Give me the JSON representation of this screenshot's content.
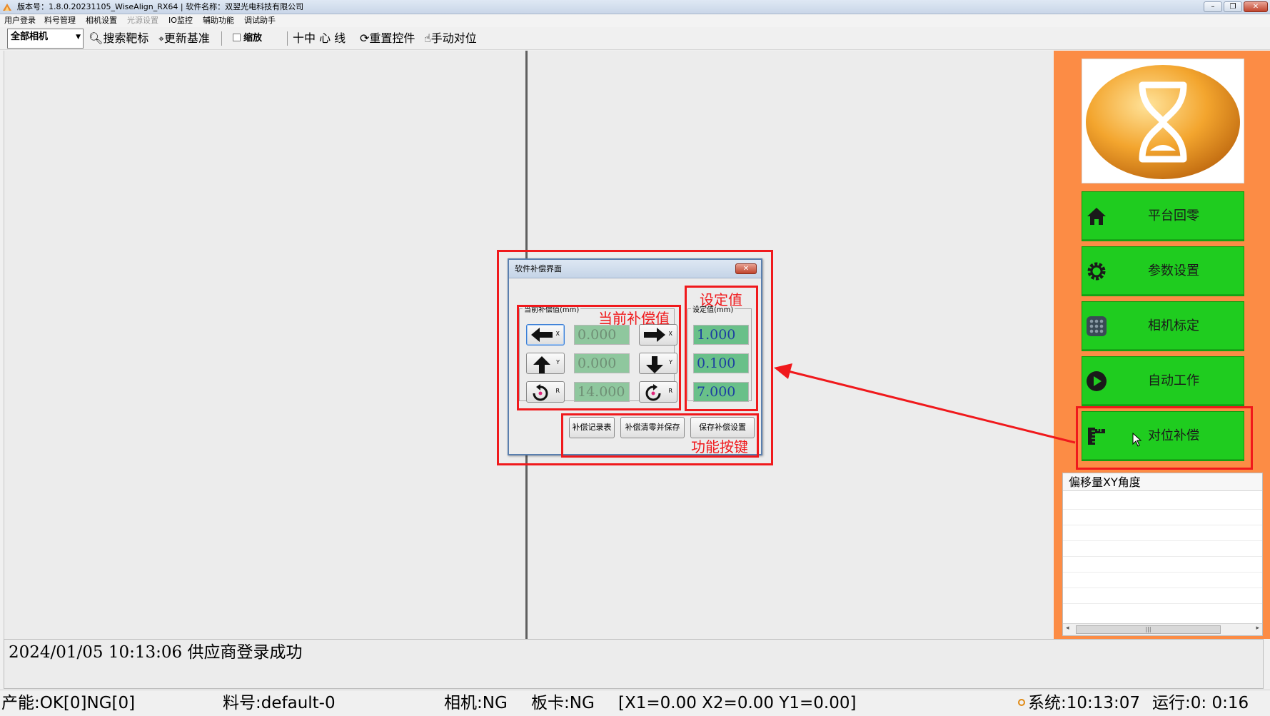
{
  "window": {
    "title": "版本号：1.8.0.20231105_WiseAlign_RX64 | 软件名称：双翌光电科技有限公司",
    "minimize_glyph": "–",
    "maximize_glyph": "❐",
    "close_glyph": "✕"
  },
  "menu": {
    "items": [
      {
        "label": "用户登录",
        "enabled": true
      },
      {
        "label": "料号管理",
        "enabled": true
      },
      {
        "label": "相机设置",
        "enabled": true
      },
      {
        "label": "光源设置",
        "enabled": false
      },
      {
        "label": "IO监控",
        "enabled": true
      },
      {
        "label": "辅助功能",
        "enabled": true
      },
      {
        "label": "调试助手",
        "enabled": true
      }
    ]
  },
  "toolbar": {
    "camera_select": "全部相机",
    "search_target": "搜索靶标",
    "update_reference": "更新基准",
    "zoom_label": "缩放",
    "zoom_checked": false,
    "center_cross": "十中 心 线",
    "reset_controls": "重置控件",
    "manual_align": "手动对位"
  },
  "side_nav": {
    "buttons": [
      {
        "label": "平台回零",
        "icon": "home-icon"
      },
      {
        "label": "参数设置",
        "icon": "gear-icon"
      },
      {
        "label": "相机标定",
        "icon": "calibration-dots-icon"
      },
      {
        "label": "自动工作",
        "icon": "play-icon"
      },
      {
        "label": "对位补偿",
        "icon": "ruler-icon"
      }
    ],
    "accent_color": "#1fcc1f",
    "panel_color": "#fc8c45"
  },
  "offset_panel": {
    "header": "偏移量XY角度",
    "scroll_glyph": "|||",
    "scroll_left": "◂",
    "scroll_right": "▸"
  },
  "dialog": {
    "title": "软件补偿界面",
    "close_glyph": "✕",
    "current_group_title": "当前补偿值(mm)",
    "set_group_title": "设定值(mm)",
    "rows": [
      {
        "axis": "X",
        "current": "0.000",
        "set": "1.000"
      },
      {
        "axis": "Y",
        "current": "0.000",
        "set": "0.100"
      },
      {
        "axis": "R",
        "current": "14.000",
        "set": "7.000"
      }
    ],
    "buttons": {
      "record_table": "补偿记录表",
      "clear_save": "补偿清零并保存",
      "save_settings": "保存补偿设置"
    }
  },
  "annotations": {
    "set_value": "设定值",
    "current_value": "当前补偿值",
    "function_keys": "功能按键",
    "color": "#f0191c"
  },
  "log": {
    "line": "2024/01/05 10:13:06 供应商登录成功"
  },
  "status": {
    "production": "产能:OK[0]NG[0]",
    "material": "料号:default-0",
    "camera": "相机:NG",
    "board": "板卡:NG",
    "coords": "[X1=0.00 X2=0.00 Y1=0.00]",
    "system_time": "系统:10:13:07",
    "runtime": "运行:0: 0:16"
  }
}
